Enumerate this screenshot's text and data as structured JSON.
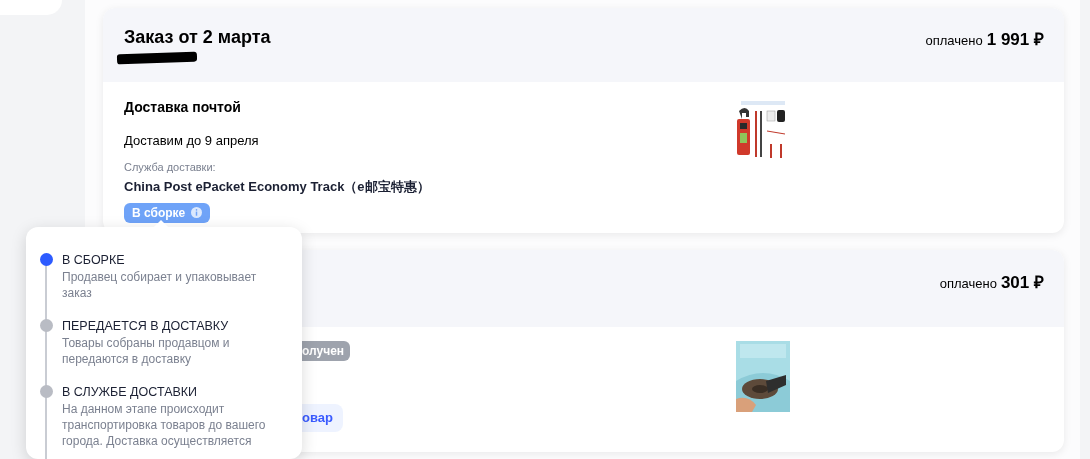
{
  "orders": [
    {
      "title": "Заказ от 2 марта",
      "paid_label": "оплачено",
      "amount": "1 991 ₽",
      "delivery": {
        "title": "Доставка почтой",
        "date": "Доставим до 9 апреля",
        "service_label": "Служба доставки:",
        "service": "China Post ePacket Economy Track（e邮宝特惠）"
      },
      "status": {
        "text": "В сборке",
        "kind": "assembling"
      }
    },
    {
      "paid_label": "оплачено",
      "amount": "301 ₽",
      "status": {
        "text": "олучен",
        "kind": "received"
      },
      "action": "овар"
    }
  ],
  "status_popover": {
    "steps": [
      {
        "title": "В СБОРКЕ",
        "description": "Продавец собирает и упаковывает заказ",
        "current": true
      },
      {
        "title": "ПЕРЕДАЕТСЯ В ДОСТАВКУ",
        "description": "Товары собраны продавцом и передаются в доставку",
        "current": false
      },
      {
        "title": "В СЛУЖБЕ ДОСТАВКИ",
        "description": "На данном этапе происходит транспортировка товаров до вашего города. Доставка осуществляется",
        "current": false
      }
    ]
  }
}
